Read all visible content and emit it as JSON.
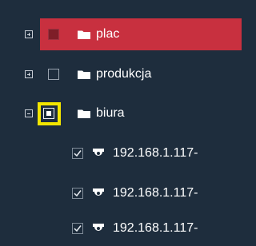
{
  "tree": {
    "folders": [
      {
        "label": "plac",
        "expander": "plus",
        "state": "selected-filled"
      },
      {
        "label": "produkcja",
        "expander": "plus",
        "state": "unchecked"
      },
      {
        "label": "biura",
        "expander": "minus",
        "state": "partial"
      }
    ],
    "cameras": [
      {
        "label": "192.168.1.117-",
        "checked": true
      },
      {
        "label": "192.168.1.117-",
        "checked": true
      },
      {
        "label": "192.168.1.117-",
        "checked": true
      }
    ]
  },
  "colors": {
    "background": "#1e2d3d",
    "selected_row": "#c8303f",
    "focus_ring": "#f3e600"
  },
  "icons": [
    "folder-icon",
    "camera-icon",
    "checkmark-icon",
    "expand-icon",
    "collapse-icon"
  ]
}
